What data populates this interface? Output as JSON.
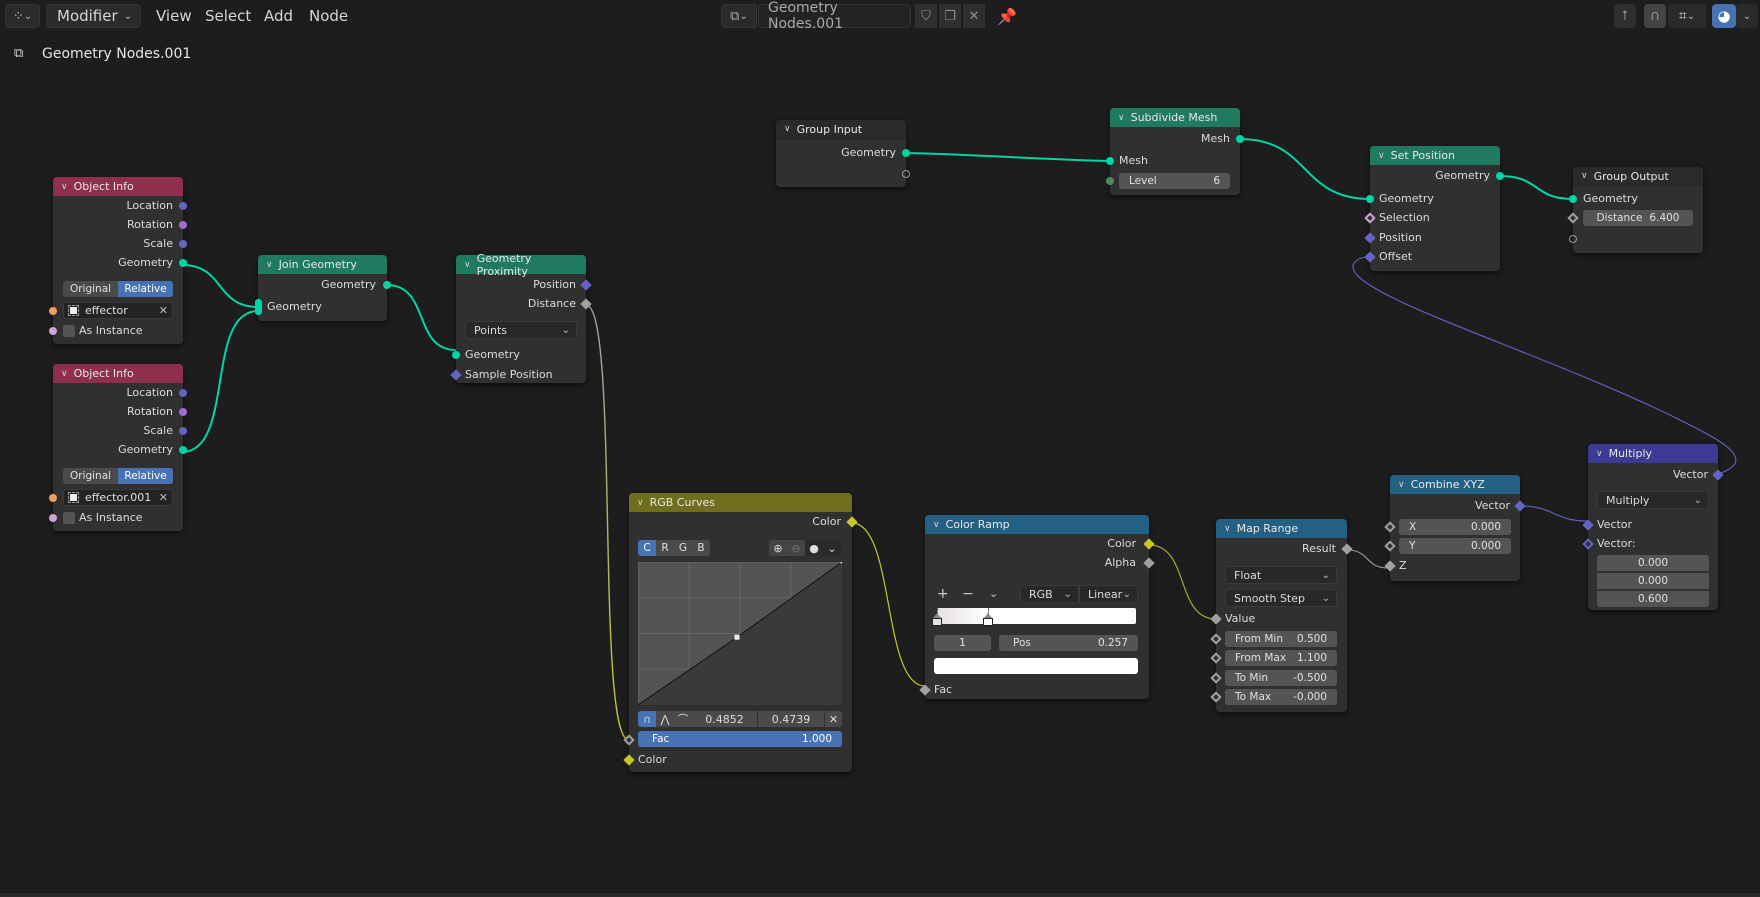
{
  "topbar": {
    "editor_type_icon": "node-editor-icon",
    "mode": "Modifier",
    "menus": [
      "View",
      "Select",
      "Add",
      "Node"
    ],
    "tree_type_icon": "node-tree-icon",
    "tree_name": "Geometry Nodes.001",
    "tree_buttons": [
      "fake-user-shield-icon",
      "duplicate-icon",
      "unlink-x-icon"
    ],
    "pin_icon": "pin-icon",
    "right_buttons": [
      "parent-node-tree-icon",
      "snap-magnet-icon",
      "snap-grid-icon",
      "overlay-icon"
    ]
  },
  "breadcrumb": {
    "icon": "node-tree-icon",
    "label": "Geometry Nodes.001"
  },
  "colors": {
    "geometry_socket": "#00d6a3",
    "vector_socket": "#6363c7",
    "float_socket": "#a1a1a1",
    "color_socket": "#c7c729",
    "accent": "#4772b3",
    "header_geometry": "#1f7a5f",
    "header_object": "#8e2f4b",
    "header_color": "#6e6e1d",
    "header_converter": "#245f84",
    "header_vector": "#3c3a93"
  },
  "nodes": {
    "object_info_1": {
      "title": "Object Info",
      "outputs": [
        "Location",
        "Rotation",
        "Scale",
        "Geometry"
      ],
      "transform_space": [
        "Original",
        "Relative"
      ],
      "transform_space_selected": "Relative",
      "object": "effector",
      "as_instance_label": "As Instance",
      "as_instance": false
    },
    "object_info_2": {
      "title": "Object Info",
      "outputs": [
        "Location",
        "Rotation",
        "Scale",
        "Geometry"
      ],
      "transform_space": [
        "Original",
        "Relative"
      ],
      "transform_space_selected": "Relative",
      "object": "effector.001",
      "as_instance_label": "As Instance",
      "as_instance": false
    },
    "join_geometry": {
      "title": "Join Geometry",
      "output": "Geometry",
      "input": "Geometry"
    },
    "geometry_proximity": {
      "title": "Geometry Proximity",
      "outputs": [
        "Position",
        "Distance"
      ],
      "target_element": "Points",
      "inputs": [
        "Geometry",
        "Sample Position"
      ]
    },
    "group_input": {
      "title": "Group Input",
      "outputs": [
        "Geometry"
      ]
    },
    "subdivide_mesh": {
      "title": "Subdivide Mesh",
      "output": "Mesh",
      "input": "Mesh",
      "level_label": "Level",
      "level": "6"
    },
    "set_position": {
      "title": "Set Position",
      "output": "Geometry",
      "inputs": [
        "Geometry",
        "Selection",
        "Position",
        "Offset"
      ]
    },
    "group_output": {
      "title": "Group Output",
      "input": "Geometry",
      "distance_label": "Distance",
      "distance": "6.400"
    },
    "rgb_curves": {
      "title": "RGB Curves",
      "output": "Color",
      "channels": [
        "C",
        "R",
        "G",
        "B"
      ],
      "channel_selected": "C",
      "point_x": "0.4852",
      "point_y": "0.4739",
      "curve_points": [
        [
          0,
          0
        ],
        [
          0.4852,
          0.4739
        ],
        [
          1,
          1
        ]
      ],
      "fac_label": "Fac",
      "fac": "1.000",
      "fac_fraction": 1.0,
      "input": "Color"
    },
    "color_ramp": {
      "title": "Color Ramp",
      "outputs": [
        "Color",
        "Alpha"
      ],
      "color_mode": "RGB",
      "interpolation": "Linear",
      "stops": [
        {
          "pos": 0.0,
          "color": "#e6e1e6"
        },
        {
          "pos": 0.257,
          "color": "#ffffff"
        }
      ],
      "active_index": "1",
      "pos_label": "Pos",
      "pos": "0.257",
      "active_color": "#ffffff",
      "input": "Fac"
    },
    "map_range": {
      "title": "Map Range",
      "output": "Result",
      "data_type": "Float",
      "interpolation": "Smooth Step",
      "value_label": "Value",
      "fields": [
        {
          "label": "From Min",
          "value": "0.500"
        },
        {
          "label": "From Max",
          "value": "1.100"
        },
        {
          "label": "To Min",
          "value": "-0.500"
        },
        {
          "label": "To Max",
          "value": "-0.000"
        }
      ]
    },
    "combine_xyz": {
      "title": "Combine XYZ",
      "output": "Vector",
      "fields": [
        {
          "label": "X",
          "value": "0.000"
        },
        {
          "label": "Y",
          "value": "0.000"
        }
      ],
      "z_label": "Z"
    },
    "multiply": {
      "title": "Multiply",
      "output": "Vector",
      "operation": "Multiply",
      "inputs": [
        "Vector",
        "Vector:"
      ],
      "vector_values": [
        "0.000",
        "0.000",
        "0.600"
      ]
    }
  }
}
